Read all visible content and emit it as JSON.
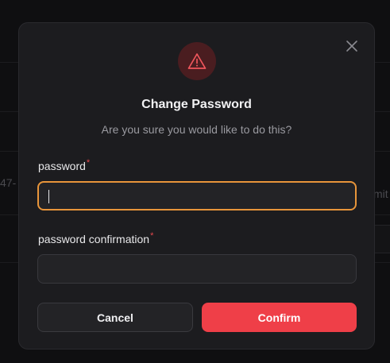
{
  "background": {
    "fragment_left": "47-",
    "fragment_right": "mit"
  },
  "dialog": {
    "title": "Change Password",
    "subtitle": "Are you sure you would like to do this?",
    "icon": "warning-triangle-icon",
    "close_icon": "close-icon",
    "fields": [
      {
        "label": "password",
        "required_mark": "*",
        "value": "",
        "placeholder": ""
      },
      {
        "label": "password confirmation",
        "required_mark": "*",
        "value": "",
        "placeholder": ""
      }
    ],
    "cancel_label": "Cancel",
    "confirm_label": "Confirm"
  },
  "colors": {
    "accent_danger": "#ef3f48",
    "focus_ring": "#e8953a",
    "warning_bg": "#4a1d20",
    "required": "#e5484d"
  }
}
